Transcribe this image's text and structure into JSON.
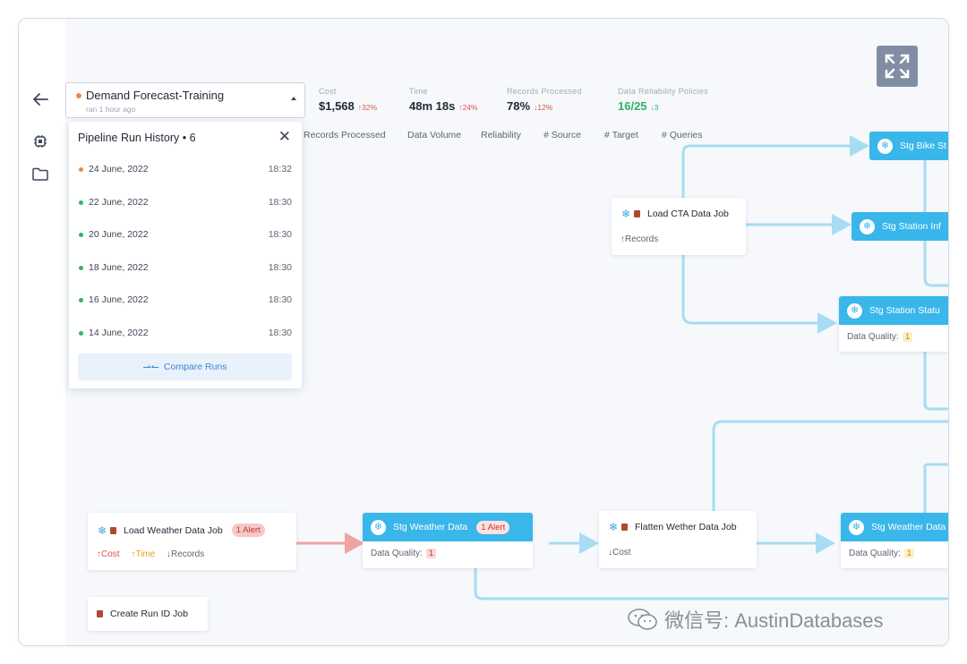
{
  "pipeline": {
    "name": "Demand Forecast-Training",
    "last_run": "ran 1 hour ago"
  },
  "metrics": [
    {
      "label": "Cost",
      "value": "$1,568",
      "delta": "↑32%",
      "tone": "up-red"
    },
    {
      "label": "Time",
      "value": "48m 18s",
      "delta": "↑24%",
      "tone": "up-red"
    },
    {
      "label": "Records Processed",
      "value": "78%",
      "delta": "↓12%",
      "tone": "down-red"
    },
    {
      "label": "Data Reliability Policies",
      "value": "16/25",
      "delta": "↓3",
      "tone": "down-green"
    }
  ],
  "run_history": {
    "title": "Pipeline Run History",
    "count": "6",
    "runs": [
      {
        "date": "24 June, 2022",
        "time": "18:32",
        "status_color": "#f0884b"
      },
      {
        "date": "22 June, 2022",
        "time": "18:30",
        "status_color": "#2fb36a"
      },
      {
        "date": "20 June, 2022",
        "time": "18:30",
        "status_color": "#2fb36a"
      },
      {
        "date": "18 June, 2022",
        "time": "18:30",
        "status_color": "#2fb36a"
      },
      {
        "date": "16 June, 2022",
        "time": "18:30",
        "status_color": "#2fb36a"
      },
      {
        "date": "14 June, 2022",
        "time": "18:30",
        "status_color": "#2fb36a"
      }
    ],
    "compare_label": "Compare Runs"
  },
  "columns": [
    "Records Processed",
    "Data Volume",
    "Reliability",
    "# Source",
    "# Target",
    "# Queries"
  ],
  "nodes": {
    "load_cta": {
      "title": "Load CTA Data Job",
      "tags": [
        "↑Records"
      ]
    },
    "load_weather": {
      "title": "Load Weather Data Job",
      "alert": "1 Alert",
      "tags": [
        "↑Cost",
        "↑Time",
        "↓Records"
      ]
    },
    "create_run_id": {
      "title": "Create Run ID Job"
    },
    "flatten_weather": {
      "title": "Flatten Wether Data Job",
      "tags": [
        "↓Cost"
      ]
    },
    "stg_weather": {
      "title": "Stg Weather Data",
      "alert": "1 Alert",
      "dq_label": "Data Quality:",
      "dq_value": "1"
    },
    "stg_bike": {
      "title": "Stg Bike St"
    },
    "stg_station_info": {
      "title": "Stg Station Inf"
    },
    "stg_station_status": {
      "title": "Stg Station Statu",
      "dq_label": "Data Quality:",
      "dq_value": "1"
    },
    "stg_weather_right": {
      "title": "Stg Weather Data",
      "dq_label": "Data Quality:",
      "dq_value": "1"
    }
  },
  "icons": {
    "back": "arrow-left-icon",
    "cpu": "cpu-chip-icon",
    "folder": "folder-icon",
    "expand": "expand-icon",
    "close": "close-icon",
    "snowflake": "snowflake-icon",
    "databricks": "databricks-icon"
  },
  "colors": {
    "accent": "#39b6ea",
    "edge": "#a8dcf3",
    "alert_edge": "#f0a3a3",
    "alert": "#c0392b",
    "ok": "#2fb36a",
    "warn": "#f0884b"
  },
  "watermark": "微信号: AustinDatabases"
}
